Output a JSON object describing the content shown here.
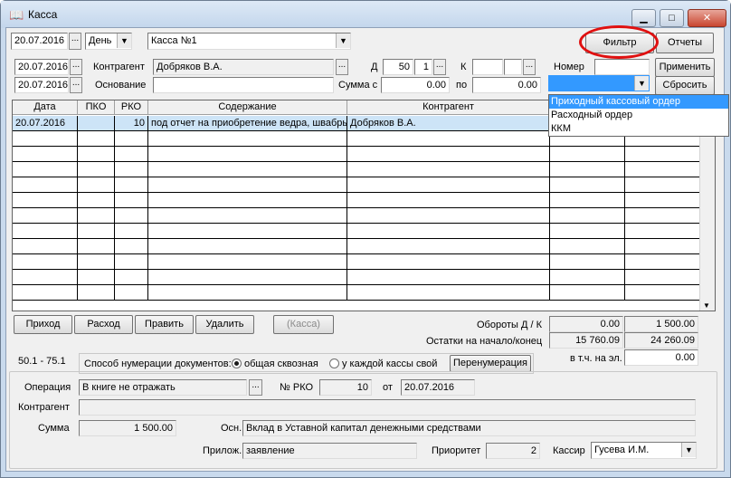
{
  "window": {
    "title": "Касса",
    "minimize": "▁",
    "maximize": "□",
    "close": "✕",
    "icon": "book-icon"
  },
  "top": {
    "date": "20.07.2016",
    "period": "День",
    "cashbox": "Касса №1",
    "filter_btn": "Фильтр",
    "reports_btn": "Отчеты"
  },
  "filter": {
    "date_from": "20.07.2016",
    "date_to": "20.07.2016",
    "contragent_label": "Контрагент",
    "contragent_value": "Добряков В.А.",
    "basis_label": "Основание",
    "basis_value": "",
    "d_label": "Д",
    "d_account": "50",
    "d_sub": "1",
    "k_label": "К",
    "k_account": "",
    "k_sub": "",
    "sum_from_label": "Сумма с",
    "sum_from": "0.00",
    "sum_to_label": "по",
    "sum_to": "0.00",
    "number_label": "Номер",
    "number_value": "",
    "apply_btn": "Применить",
    "reset_btn": "Сбросить",
    "doc_type_value": "",
    "doc_type_options": [
      "Приходный кассовый ордер",
      "Расходный ордер",
      "ККМ"
    ]
  },
  "table": {
    "columns": [
      "Дата",
      "ПКО",
      "РКО",
      "Содержание",
      "Контрагент"
    ],
    "rows": [
      {
        "date": "20.07.2016",
        "pko": "",
        "rko": "10",
        "content": "под отчет на приобретение ведра, швабры",
        "contragent": "Добряков В.А."
      }
    ]
  },
  "actions": {
    "incoming": "Приход",
    "outgoing": "Расход",
    "edit": "Править",
    "delete": "Удалить",
    "cashbox": "(Касса)"
  },
  "totals": {
    "turnover_label": "Обороты Д / К",
    "turnover_d": "0.00",
    "turnover_k": "1 500.00",
    "balance_label": "Остатки на начало/конец",
    "balance_start": "15 760.09",
    "balance_end": "24 260.09",
    "incl_label": "в т.ч. на эл.",
    "incl_value": "0.00"
  },
  "numbering": {
    "accounts": "50.1 - 75.1",
    "label": "Способ нумерации документов:",
    "opt_common": "общая сквозная",
    "opt_each": "у каждой кассы свой",
    "renumber_btn": "Перенумерация"
  },
  "details": {
    "operation_label": "Операция",
    "operation_value": "В книге не отражать",
    "rko_label": "№ РКО",
    "rko_value": "10",
    "from_label": "от",
    "from_value": "20.07.2016",
    "contragent_label": "Контрагент",
    "contragent_value": "",
    "sum_label": "Сумма",
    "sum_value": "1 500.00",
    "basis_label": "Осн.",
    "basis_value": "Вклад в Уставной капитал денежными средствами",
    "attach_label": "Прилож.",
    "attach_value": "заявление",
    "priority_label": "Приоритет",
    "priority_value": "2",
    "cashier_label": "Кассир",
    "cashier_value": "Гусева И.М."
  },
  "colors": {
    "selection": "#3399ff",
    "highlight_row": "#cde4f7",
    "annotation": "#e01010"
  }
}
